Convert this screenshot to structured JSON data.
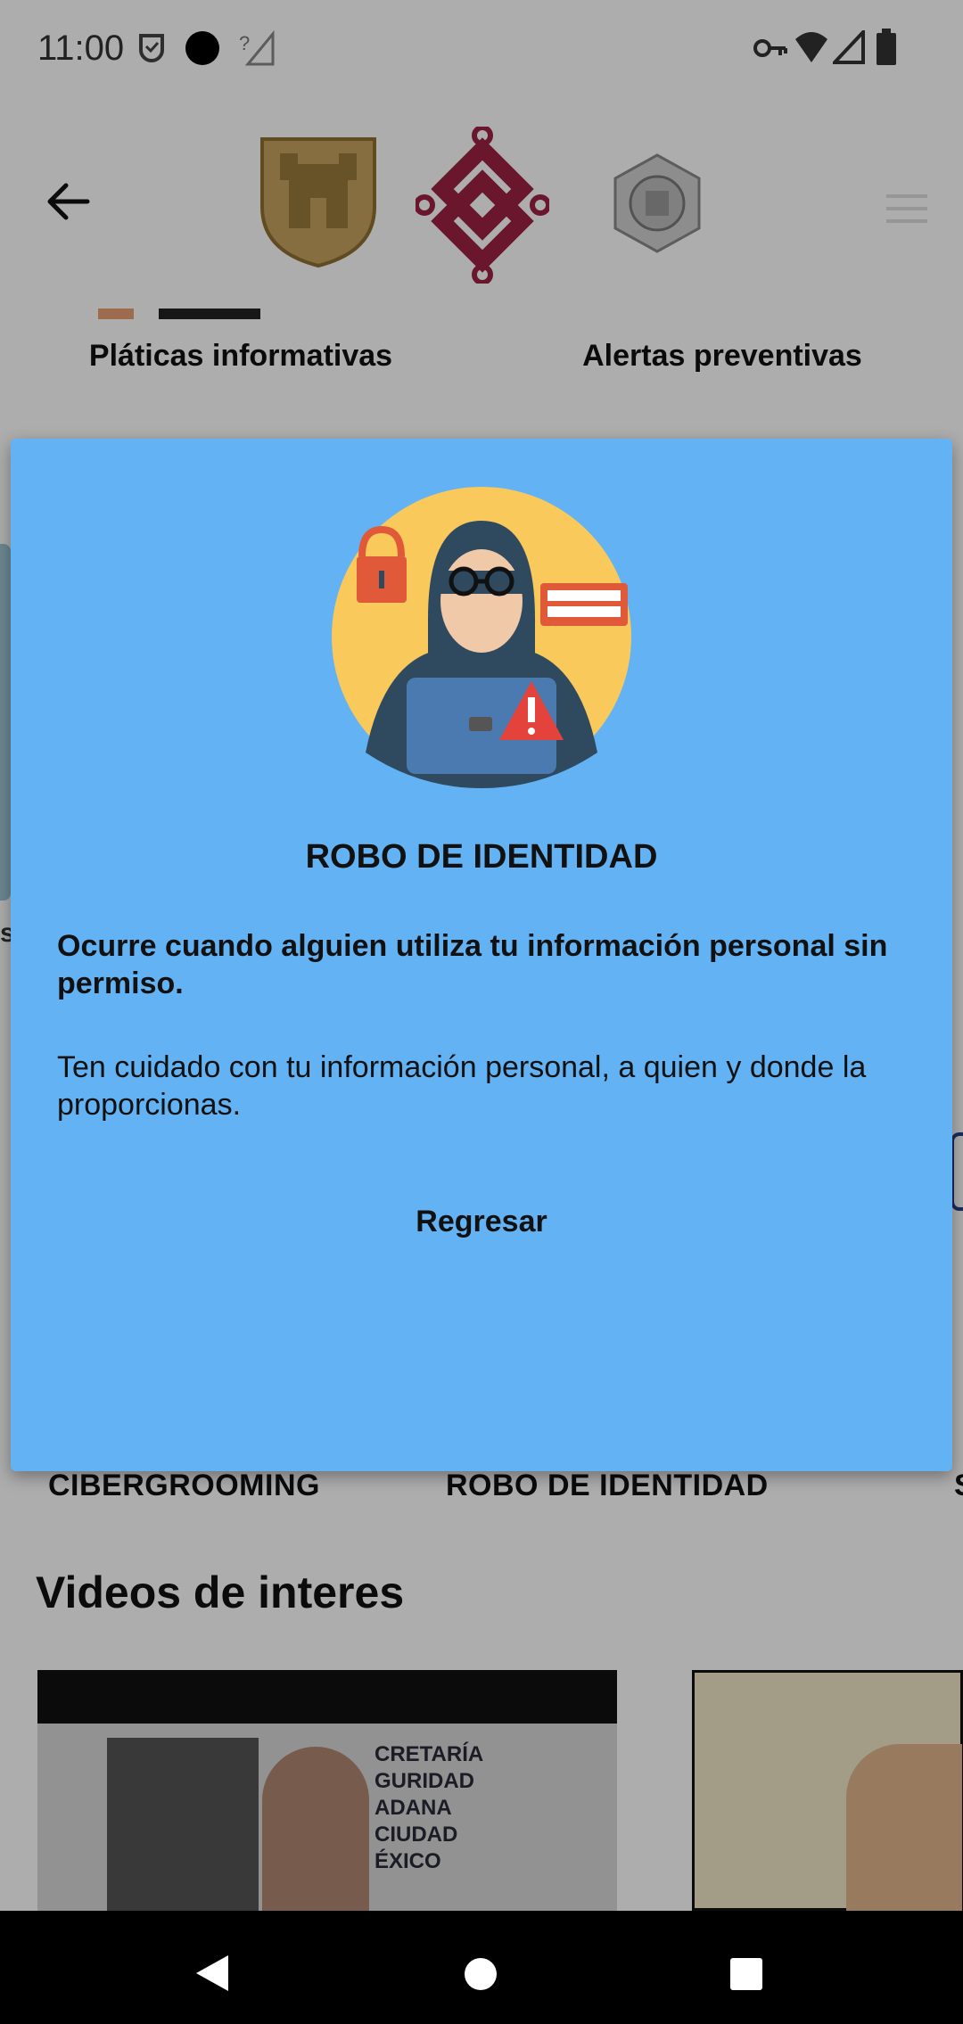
{
  "status_bar": {
    "time": "11:00",
    "icons": [
      "shield-check-icon",
      "camera-dot-icon",
      "no-signal-icon",
      "vpn-key-icon",
      "wifi-icon",
      "cell-signal-icon",
      "battery-icon"
    ]
  },
  "header": {
    "back_icon": "arrow-left-icon",
    "logos": [
      "cdmx-shield-logo",
      "cdmx-knot-logo",
      "police-badge-logo"
    ],
    "menu_icon": "hamburger-menu-icon"
  },
  "top_sections": [
    {
      "label": "Pláticas informativas"
    },
    {
      "label": "Alertas preventivas"
    }
  ],
  "cards": [
    {
      "title": "CIBERGROOMING"
    },
    {
      "title": "ROBO DE IDENTIDAD"
    }
  ],
  "videos": {
    "heading": "Videos de interes",
    "thumb_text": [
      "CRETARÍA",
      "GURIDAD",
      "ADANA",
      "CIUDAD",
      "ÉXICO"
    ]
  },
  "dialog": {
    "title": "ROBO DE IDENTIDAD",
    "description_bold": "Ocurre cuando alguien utiliza tu información personal sin permiso.",
    "description": "Ten cuidado con tu información personal, a quien y donde la proporcionas.",
    "back_button": "Regresar",
    "illustration": "hacker-laptop-illustration",
    "colors": {
      "background": "#63b3f4",
      "circle": "#f9c95c",
      "hood": "#2f4a5f",
      "lock": "#e05a3a",
      "warning": "#e3433a"
    }
  },
  "nav_bar": {
    "icons": [
      "back-triangle-icon",
      "home-circle-icon",
      "recents-square-icon"
    ]
  }
}
